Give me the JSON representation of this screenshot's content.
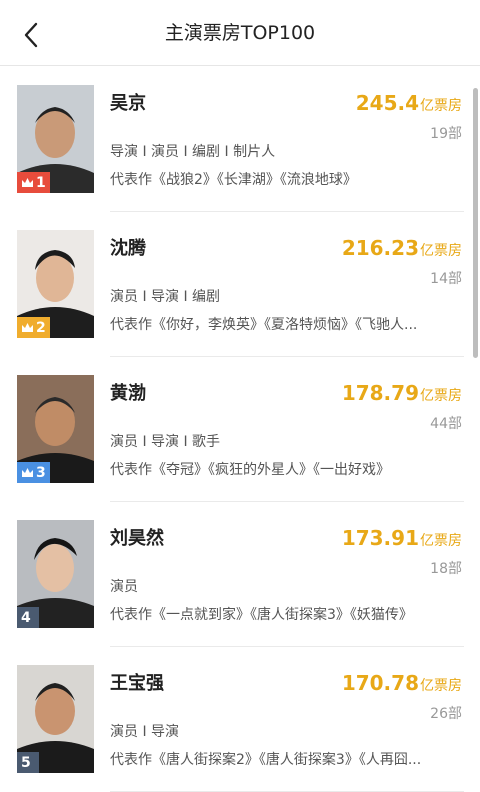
{
  "header": {
    "title": "主演票房TOP100"
  },
  "unit": "亿票房",
  "colors": {
    "accent": "#e8a817",
    "rank_gold": "#e74c3c",
    "rank_silver": "#f0ad2e",
    "rank_bronze": "#4a90e2",
    "rank_other": "#4a5a70"
  },
  "items": [
    {
      "rank": "1",
      "name": "吴京",
      "box": "245.4",
      "count": "19部",
      "roles": "导演 I 演员 I 编剧 I 制片人",
      "works": "代表作《战狼2》《长津湖》《流浪地球》"
    },
    {
      "rank": "2",
      "name": "沈腾",
      "box": "216.23",
      "count": "14部",
      "roles": "演员 I 导演 I 编剧",
      "works": "代表作《你好，李焕英》《夏洛特烦恼》《飞驰人..."
    },
    {
      "rank": "3",
      "name": "黄渤",
      "box": "178.79",
      "count": "44部",
      "roles": "演员 I 导演 I 歌手",
      "works": "代表作《夺冠》《疯狂的外星人》《一出好戏》"
    },
    {
      "rank": "4",
      "name": "刘昊然",
      "box": "173.91",
      "count": "18部",
      "roles": "演员",
      "works": "代表作《一点就到家》《唐人街探案3》《妖猫传》"
    },
    {
      "rank": "5",
      "name": "王宝强",
      "box": "170.78",
      "count": "26部",
      "roles": "演员 I 导演",
      "works": "代表作《唐人街探案2》《唐人街探案3》《人再囧..."
    }
  ]
}
